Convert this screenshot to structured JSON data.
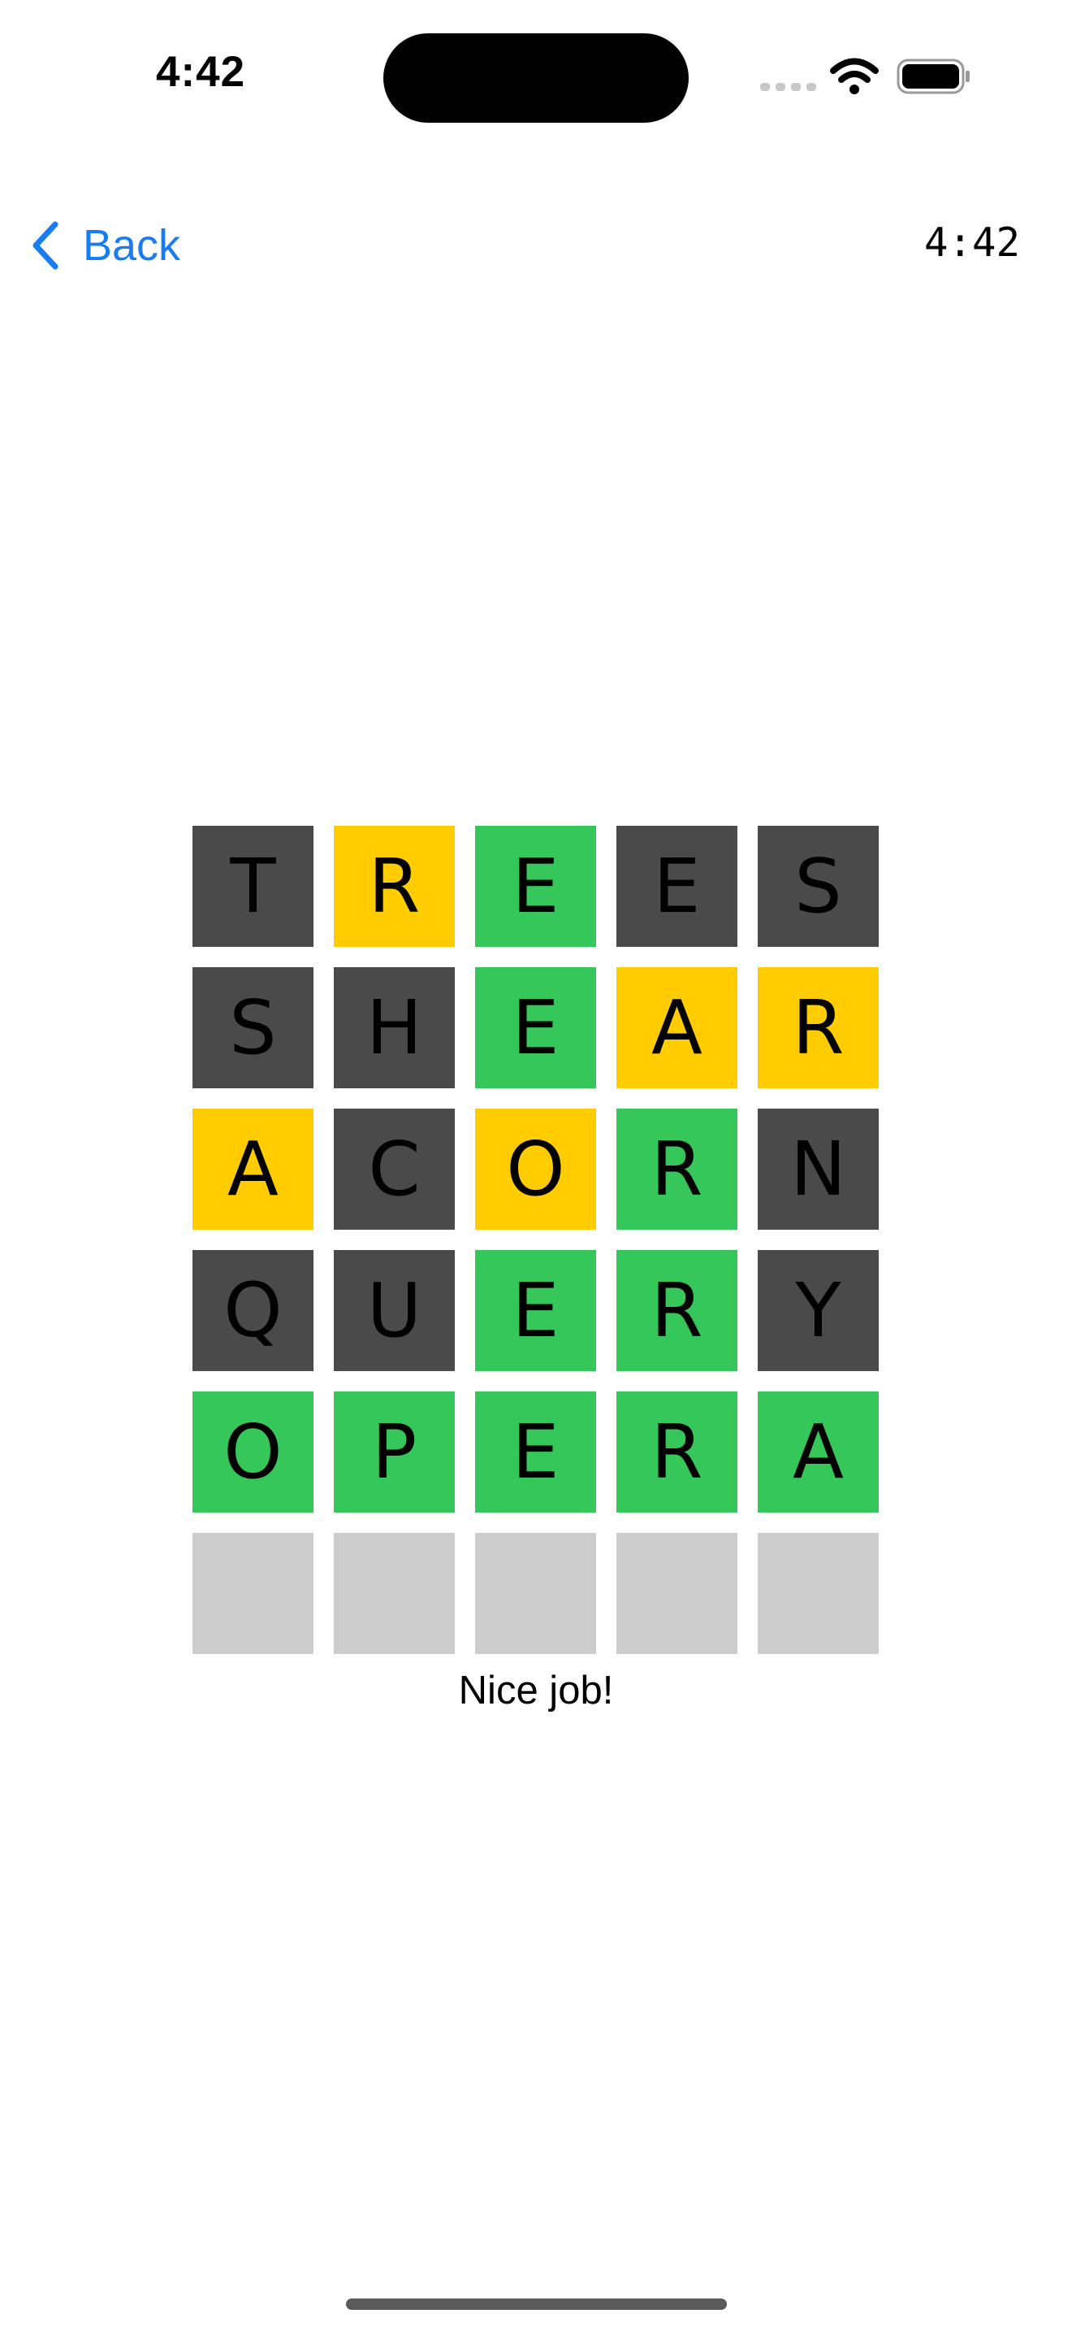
{
  "status_bar": {
    "time": "4:42",
    "icons": [
      "cellular-signal-icon",
      "wifi-icon",
      "battery-icon"
    ]
  },
  "nav": {
    "back_label": "Back",
    "back_icon": "chevron-left-icon",
    "timer": "4:42"
  },
  "colors": {
    "accent": "#1a7cf2",
    "absent": "#4a4a4a",
    "present": "#ffcc00",
    "correct": "#35c759",
    "empty": "#cccccc"
  },
  "board": {
    "rows": [
      {
        "letters": [
          "T",
          "R",
          "E",
          "E",
          "S"
        ],
        "states": [
          "absent",
          "present",
          "correct",
          "absent",
          "absent"
        ]
      },
      {
        "letters": [
          "S",
          "H",
          "E",
          "A",
          "R"
        ],
        "states": [
          "absent",
          "absent",
          "correct",
          "present",
          "present"
        ]
      },
      {
        "letters": [
          "A",
          "C",
          "O",
          "R",
          "N"
        ],
        "states": [
          "present",
          "absent",
          "present",
          "correct",
          "absent"
        ]
      },
      {
        "letters": [
          "Q",
          "U",
          "E",
          "R",
          "Y"
        ],
        "states": [
          "absent",
          "absent",
          "correct",
          "correct",
          "absent"
        ]
      },
      {
        "letters": [
          "O",
          "P",
          "E",
          "R",
          "A"
        ],
        "states": [
          "correct",
          "correct",
          "correct",
          "correct",
          "correct"
        ]
      },
      {
        "letters": [
          "",
          "",
          "",
          "",
          ""
        ],
        "states": [
          "empty",
          "empty",
          "empty",
          "empty",
          "empty"
        ]
      }
    ]
  },
  "message": "Nice job!"
}
